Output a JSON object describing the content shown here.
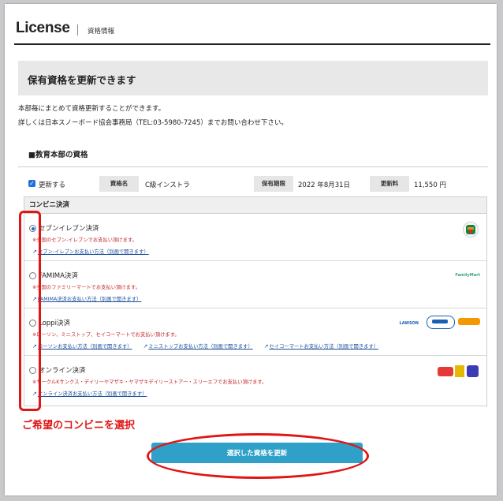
{
  "header": {
    "brand": "License",
    "subtitle": "資格情報"
  },
  "banner": {
    "title": "保有資格を更新できます"
  },
  "intro": {
    "line1": "本部毎にまとめて資格更新することができます。",
    "line2": "詳しくは日本スノーボード協会事務局（TEL:03-5980-7245）までお問い合わせ下さい。"
  },
  "section": {
    "title": "■教育本部の資格"
  },
  "qualification": {
    "update_label": "更新する",
    "name_label": "資格名",
    "name_value": "C級インストラ",
    "expiry_label": "保有期限",
    "expiry_value": "2022 年8月31日",
    "fee_label": "更新料",
    "fee_value": "11,550 円"
  },
  "konbini": {
    "heading": "コンビニ決済",
    "options": [
      {
        "name": "セブンイレブン決済",
        "note": "※全国のセブン-イレブンでお支払い頂けます。",
        "links": [
          "セブン-イレブンお支払い方法（別画で開きます）"
        ],
        "selected": true
      },
      {
        "name": "FAMIMA決済",
        "note": "※全国のファミリーマートでお支払い頂けます。",
        "links": [
          "FAMIMA決済お支払い方法（別画で開きます）"
        ],
        "selected": false,
        "logo_text": "FamilyMart"
      },
      {
        "name": "Loppi決済",
        "note": "※ローソン、ミニストップ、セイコーマートでお支払い頂けます。",
        "links": [
          "ローソンお支払い方法（別画で開きます）",
          "ミニストップお支払い方法（別画で開きます）",
          "セイコーマートお支払い方法（別画で開きます）"
        ],
        "selected": false,
        "logo_text": "LAWSON"
      },
      {
        "name": "オンライン決済",
        "note": "※サークルKサンクス・デイリーヤマザキ・ヤマザキデイリーストアー・スリーエフでお支払い頂けます。",
        "links": [
          "オンライン決済お支払い方法（別画で開きます）"
        ],
        "selected": false
      }
    ]
  },
  "annotation": {
    "text": "ご希望のコンビニを選択"
  },
  "submit": {
    "label": "選択した資格を更新"
  },
  "colors": {
    "accent": "#2fa0c8",
    "annotation_red": "#e01515",
    "check_blue": "#1e6fd9"
  },
  "icons": [
    "checkbox-checked-icon",
    "radio-icon",
    "external-link-icon",
    "seven-eleven-logo-icon"
  ]
}
